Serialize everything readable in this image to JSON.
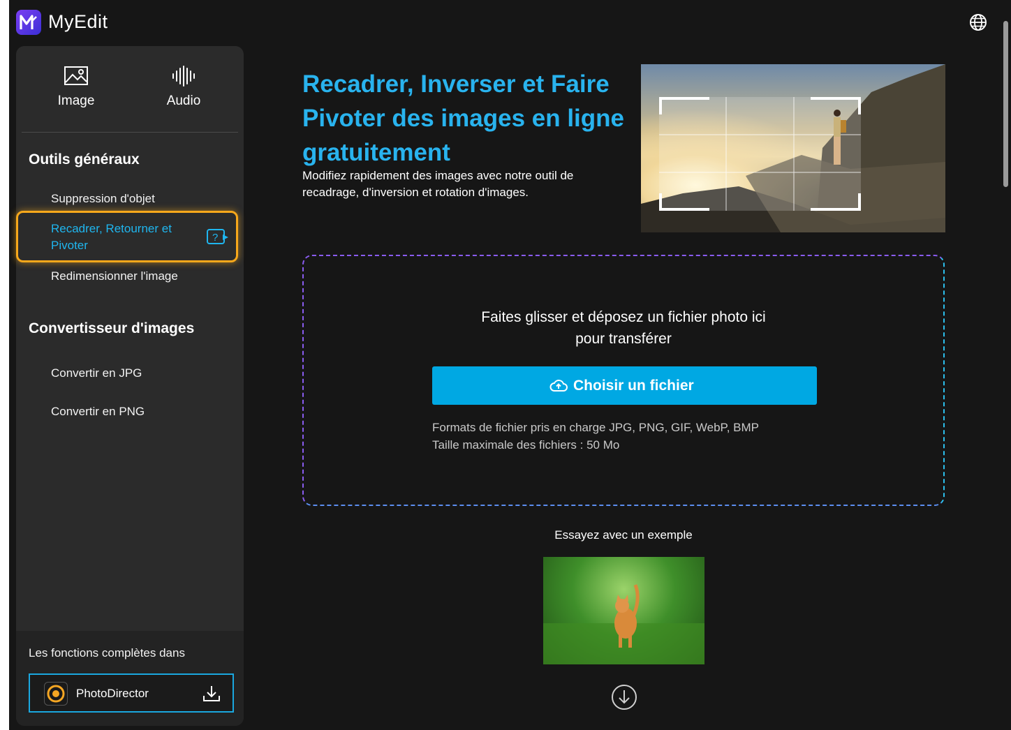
{
  "header": {
    "app_name": "MyEdit"
  },
  "sidebar": {
    "modes": [
      {
        "label": "Image",
        "icon": "image-icon"
      },
      {
        "label": "Audio",
        "icon": "audio-waveform-icon"
      }
    ],
    "section_general": "Outils généraux",
    "general_items": [
      {
        "label": "Suppression d'objet"
      },
      {
        "label": "Recadrer, Retourner et Pivoter",
        "active": true
      },
      {
        "label": "Redimensionner l'image"
      }
    ],
    "section_converter": "Convertisseur d'images",
    "converter_items": [
      {
        "label": "Convertir en JPG"
      },
      {
        "label": "Convertir en PNG"
      }
    ],
    "footer_text": "Les fonctions complètes dans",
    "photodirector_label": "PhotoDirector"
  },
  "main": {
    "hero_title": "Recadrer, Inverser et Faire Pivoter des images en ligne gratuitement",
    "hero_desc": "Modifiez rapidement des images avec notre outil de recadrage, d'inversion et rotation d'images.",
    "drop_text_line1": "Faites glisser et déposez un fichier photo ici",
    "drop_text_line2": "pour transférer",
    "choose_button": "Choisir un fichier",
    "formats_line": "Formats de fichier pris en charge JPG, PNG, GIF, WebP, BMP",
    "max_size_line": "Taille maximale des fichiers : 50 Mo",
    "example_title": "Essayez avec un exemple"
  },
  "colors": {
    "accent": "#29b3ee",
    "button": "#00a8e3",
    "highlight": "#f7a81b",
    "sidebar_bg": "#2b2b2b",
    "page_bg": "#161616"
  }
}
